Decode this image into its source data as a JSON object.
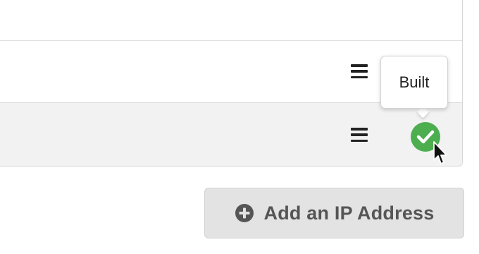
{
  "table": {
    "rows": [
      {
        "status": ""
      },
      {
        "status": ""
      },
      {
        "status": "Built"
      }
    ]
  },
  "tooltip": {
    "text": "Built"
  },
  "colors": {
    "success": "#4cae4f",
    "row_highlight": "#f2f2f2",
    "button_bg": "#e3e3e3",
    "button_text": "#555555"
  },
  "icons": {
    "row_menu": "hamburger-menu-icon",
    "status": "check-circle-icon",
    "add": "plus-circle-icon",
    "cursor": "mouse-pointer"
  },
  "add_button": {
    "label": "Add an IP Address"
  }
}
